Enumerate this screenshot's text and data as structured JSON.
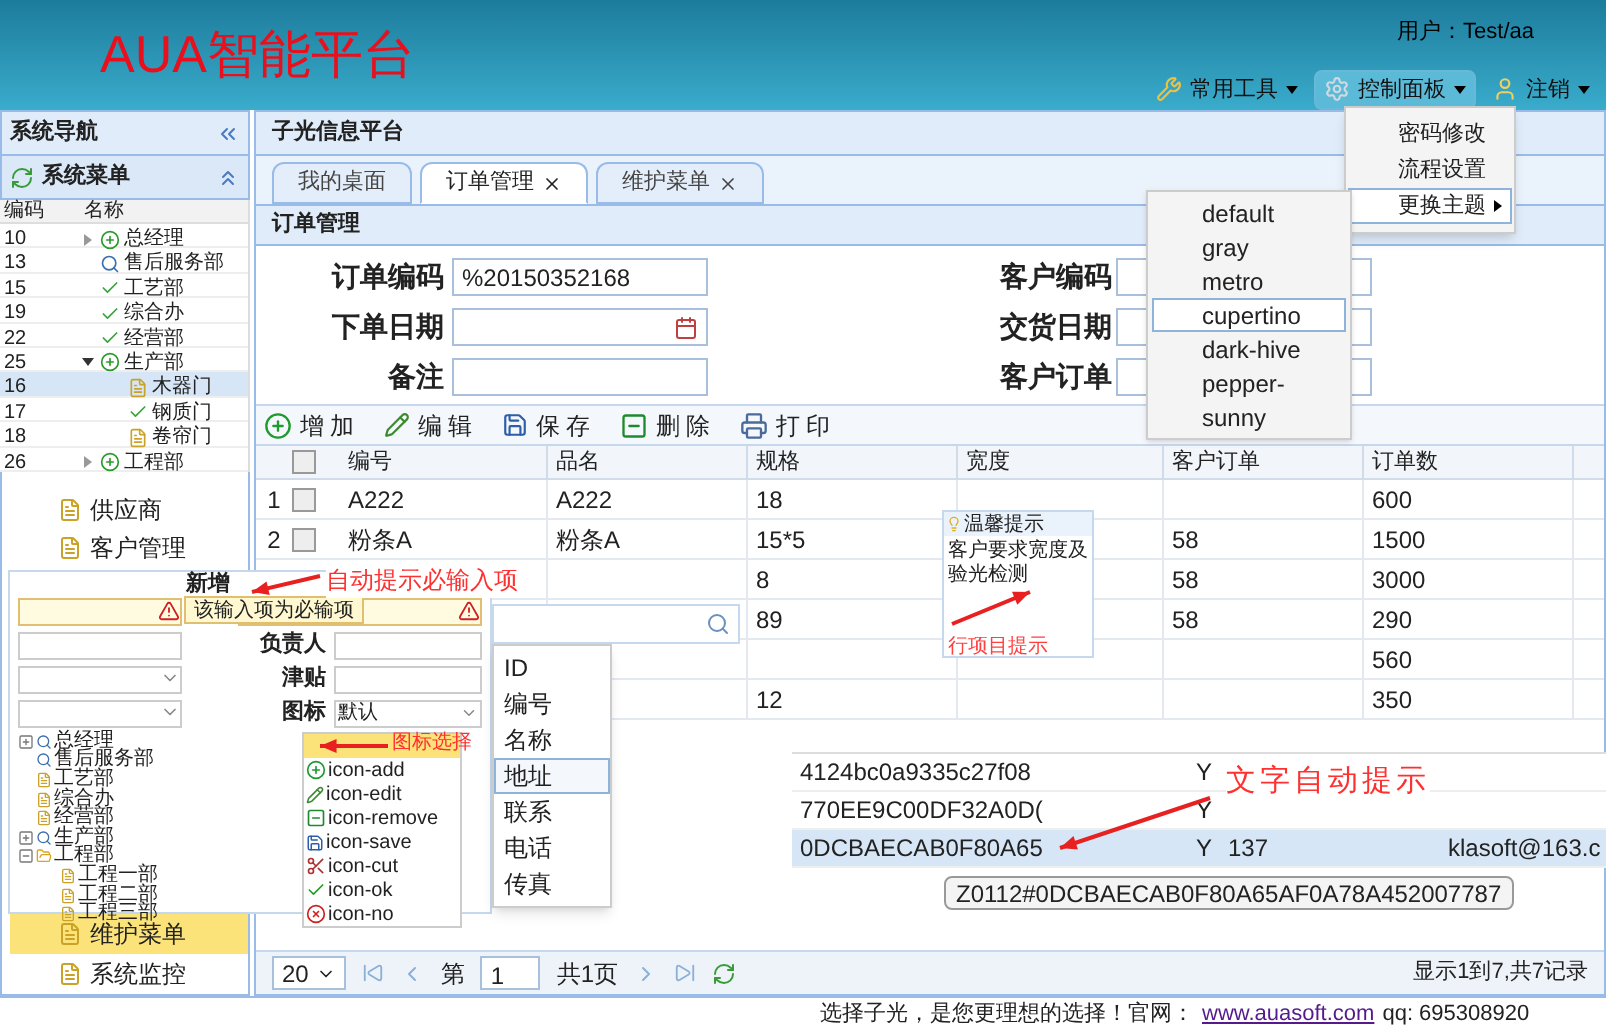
{
  "header": {
    "title": "AUA智能平台",
    "user": "用户：Test/aa",
    "tools": [
      {
        "label": "常用工具",
        "kind": "tools",
        "selected": false
      },
      {
        "label": "控制面板",
        "kind": "gear",
        "selected": true
      },
      {
        "label": "注销",
        "kind": "user",
        "selected": false
      }
    ]
  },
  "control_menu": {
    "items": [
      {
        "label": "密码修改",
        "submenu": false,
        "selected": false
      },
      {
        "label": "流程设置",
        "submenu": false,
        "selected": false
      },
      {
        "label": "更换主题",
        "submenu": true,
        "selected": true
      }
    ]
  },
  "theme_menu": {
    "items": [
      {
        "label": "default",
        "selected": false
      },
      {
        "label": "gray",
        "selected": false
      },
      {
        "label": "metro",
        "selected": false
      },
      {
        "label": "cupertino",
        "selected": true
      },
      {
        "label": "dark-hive",
        "selected": false
      },
      {
        "label": "pepper-",
        "selected": false
      },
      {
        "label": "sunny",
        "selected": false
      }
    ]
  },
  "sidebar": {
    "title": "系统导航",
    "menu_title": "系统菜单",
    "items": [
      {
        "label": "供应商",
        "selected": false
      },
      {
        "label": "客户管理",
        "selected": false
      }
    ],
    "items_below": [
      {
        "label": "维护菜单",
        "selected": true
      },
      {
        "label": "系统监控",
        "selected": false
      }
    ]
  },
  "tree_grid": {
    "columns": [
      "编码",
      "名称"
    ],
    "rows": [
      {
        "code": "10",
        "name": "总经理",
        "kind": "plus",
        "expanded": false,
        "selected": false
      },
      {
        "code": "13",
        "name": "售后服务部",
        "kind": "search",
        "selected": false
      },
      {
        "code": "15",
        "name": "工艺部",
        "kind": "check",
        "selected": false
      },
      {
        "code": "19",
        "name": "综合办",
        "kind": "check",
        "selected": false
      },
      {
        "code": "22",
        "name": "经营部",
        "kind": "check",
        "selected": false
      },
      {
        "code": "25",
        "name": "生产部",
        "kind": "plus",
        "expanded": true,
        "selected": false,
        "children": [
          {
            "code": "16",
            "name": "木器门",
            "kind": "file",
            "selected": true
          },
          {
            "code": "17",
            "name": "钢质门",
            "kind": "check",
            "selected": false
          },
          {
            "code": "18",
            "name": "卷帘门",
            "kind": "file",
            "selected": false
          }
        ]
      },
      {
        "code": "26",
        "name": "工程部",
        "kind": "plus",
        "expanded": false,
        "selected": false
      }
    ]
  },
  "main": {
    "title": "子光信息平台",
    "tabs": [
      {
        "label": "我的桌面",
        "closable": false,
        "selected": false
      },
      {
        "label": "订单管理",
        "closable": true,
        "selected": true
      },
      {
        "label": "维护菜单",
        "closable": true,
        "selected": false
      }
    ],
    "panel_title": "订单管理",
    "fields": [
      {
        "label": "订单编码",
        "value": "%20150352168",
        "kind": "text"
      },
      {
        "label": "客户编码",
        "kind": "text"
      },
      {
        "label": "下单日期",
        "kind": "date"
      },
      {
        "label": "交货日期",
        "kind": "text"
      },
      {
        "label": "备注",
        "kind": "text"
      },
      {
        "label": "客户订单",
        "kind": "text"
      }
    ],
    "toolbar": [
      {
        "label": "增加",
        "kind": "add"
      },
      {
        "label": "编辑",
        "kind": "edit"
      },
      {
        "label": "保存",
        "kind": "save"
      },
      {
        "label": "删除",
        "kind": "remove"
      },
      {
        "label": "打印",
        "kind": "print"
      }
    ],
    "select_all": {
      "checked": false
    },
    "columns": [
      "编号",
      "品名",
      "规格",
      "宽度",
      "客户订单",
      "订单数"
    ],
    "rows": [
      {
        "index": "1",
        "checked": false,
        "cells": [
          "A222",
          "A222",
          "18",
          null,
          null,
          "600"
        ]
      },
      {
        "index": "2",
        "checked": false,
        "cells": [
          "粉条A",
          "粉条A",
          "15*5",
          null,
          "58",
          "1500"
        ]
      },
      {
        "cells": [
          null,
          null,
          "8",
          null,
          "58",
          "3000"
        ]
      },
      {
        "cells": [
          null,
          null,
          "89",
          null,
          "58",
          "290"
        ]
      },
      {
        "cells": [
          null,
          null,
          null,
          null,
          null,
          "560"
        ]
      },
      {
        "cells": [
          null,
          null,
          "12",
          null,
          null,
          "350"
        ]
      }
    ],
    "pager": {
      "page_size": "20",
      "page_prefix": "第",
      "page": "1",
      "total": "共1页",
      "info": "显示1到7,共7记录"
    }
  },
  "add_dialog": {
    "title": "新增",
    "error_tip": "该输入项为必输项",
    "labels": [
      "负责人",
      "津贴",
      "图标"
    ],
    "icon_value": "默认",
    "icon_options": [
      {
        "label": "icon-add",
        "kind": "add"
      },
      {
        "label": "icon-edit",
        "kind": "edit"
      },
      {
        "label": "icon-remove",
        "kind": "remove"
      },
      {
        "label": "icon-save",
        "kind": "save"
      },
      {
        "label": "icon-cut",
        "kind": "cut"
      },
      {
        "label": "icon-ok",
        "kind": "ok"
      },
      {
        "label": "icon-no",
        "kind": "no"
      }
    ],
    "tree": [
      {
        "name": "总经理",
        "kind": "search",
        "expanded": false
      },
      {
        "name": "售后服务部",
        "kind": "search"
      },
      {
        "name": "工艺部",
        "kind": "file"
      },
      {
        "name": "综合办",
        "kind": "file"
      },
      {
        "name": "经营部",
        "kind": "file"
      },
      {
        "name": "生产部",
        "kind": "search",
        "expanded": false
      },
      {
        "name": "工程部",
        "kind": "folder",
        "expanded": true,
        "children": [
          {
            "name": "工程一部",
            "kind": "file"
          },
          {
            "name": "工程二部",
            "kind": "file"
          },
          {
            "name": "工程三部",
            "kind": "file"
          }
        ]
      }
    ]
  },
  "field_list": {
    "items": [
      {
        "label": "ID",
        "selected": false
      },
      {
        "label": "编号",
        "selected": false
      },
      {
        "label": "名称",
        "selected": false
      },
      {
        "label": "地址",
        "selected": true
      },
      {
        "label": "联系",
        "selected": false
      },
      {
        "label": "电话",
        "selected": false
      },
      {
        "label": "传真",
        "selected": false
      }
    ]
  },
  "row_tip": {
    "title": "温馨提示",
    "body": "客户要求宽度及验光检测"
  },
  "autocomplete": {
    "rows": [
      {
        "code": "4124bc0a9335c27f08",
        "flag": "Y",
        "selected": false
      },
      {
        "code": "770EE9C00DF32A0D(",
        "flag": "Y",
        "selected": false
      },
      {
        "code": "0DCBAECAB0F80A65",
        "flag": "Y",
        "number": "137",
        "email": "klasoft@163.c",
        "selected": true
      }
    ],
    "tooltip": "Z0112#0DCBAECAB0F80A65AF0A78A452007787"
  },
  "annotations": [
    "自动提示必输入项",
    "图标选择",
    "行项目提示",
    "文字自动提示"
  ],
  "footer": {
    "text": "选择子光，是您更理想的选择！官网：",
    "link": "www.auasoft.com",
    "qq": "qq: 695308920"
  }
}
